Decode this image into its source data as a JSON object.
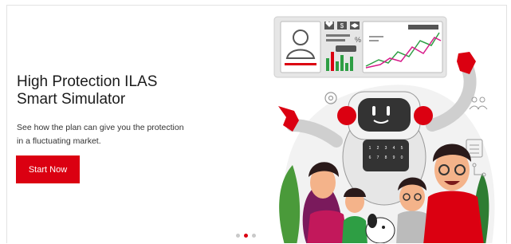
{
  "hero": {
    "title_line1": "High Protection ILAS",
    "title_line2": "Smart Simulator",
    "description": "See how the plan can give you the protection in a fluctuating market.",
    "cta_label": "Start Now"
  },
  "illustration": {
    "dashboard_symbol_currency": "$",
    "dashboard_symbol_percent": "%",
    "keypad_digits": [
      "1",
      "2",
      "3",
      "4",
      "5",
      "6",
      "7",
      "8",
      "9",
      "0"
    ]
  },
  "carousel": {
    "slide_count": 3,
    "active_index": 1
  },
  "colors": {
    "brand_red": "#db0011",
    "text_dark": "#1b1b1b",
    "dot_inactive": "#c9c9c9"
  }
}
